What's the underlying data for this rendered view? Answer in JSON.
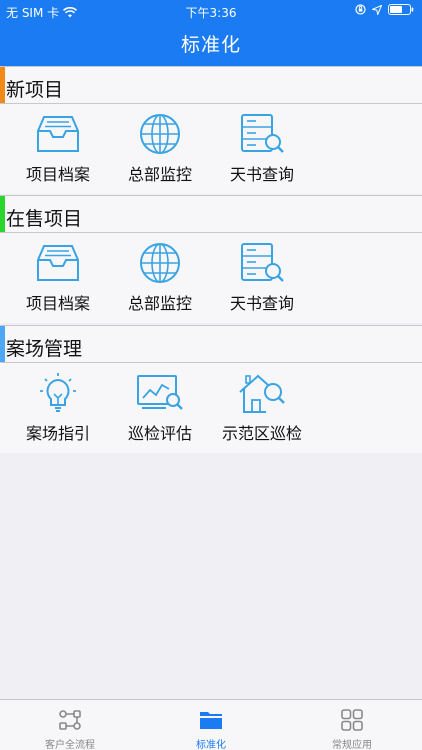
{
  "status": {
    "carrier": "无 SIM 卡",
    "time": "下午3:36"
  },
  "header": {
    "title": "标准化"
  },
  "sections": [
    {
      "title": "新项目",
      "accent": "#f28a1a",
      "items": [
        {
          "label": "项目档案",
          "icon": "inbox-icon"
        },
        {
          "label": "总部监控",
          "icon": "globe-icon"
        },
        {
          "label": "天书查询",
          "icon": "server-search-icon"
        }
      ]
    },
    {
      "title": "在售项目",
      "accent": "#2bd62b",
      "items": [
        {
          "label": "项目档案",
          "icon": "inbox-icon"
        },
        {
          "label": "总部监控",
          "icon": "globe-icon"
        },
        {
          "label": "天书查询",
          "icon": "server-search-icon"
        }
      ]
    },
    {
      "title": "案场管理",
      "accent": "#4ea6f5",
      "items": [
        {
          "label": "案场指引",
          "icon": "lightbulb-icon"
        },
        {
          "label": "巡检评估",
          "icon": "chart-search-icon"
        },
        {
          "label": "示范区巡检",
          "icon": "house-search-icon"
        }
      ]
    }
  ],
  "tabs": [
    {
      "label": "客户全流程",
      "icon": "flow-icon",
      "active": false
    },
    {
      "label": "标准化",
      "icon": "folder-icon",
      "active": true
    },
    {
      "label": "常规应用",
      "icon": "grid-icon",
      "active": false
    }
  ],
  "colors": {
    "brand": "#1a7bf2",
    "icon": "#3aa3e3"
  }
}
